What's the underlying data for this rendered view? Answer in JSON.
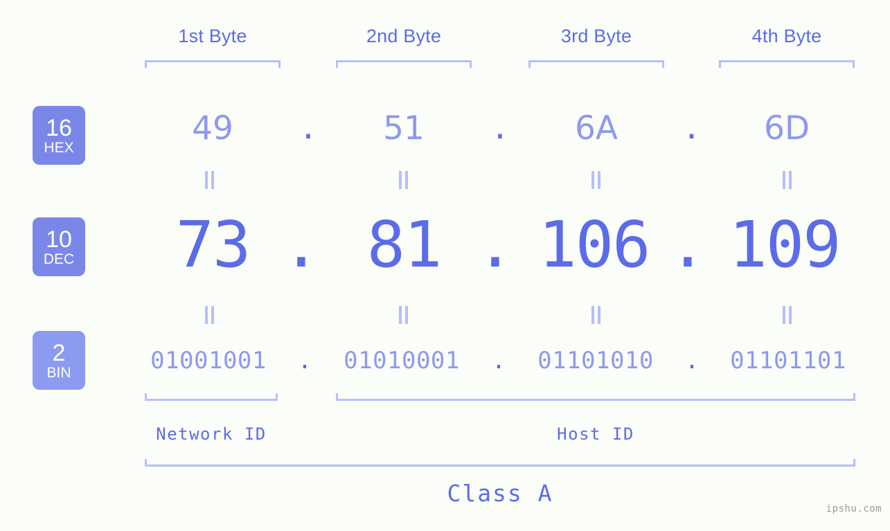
{
  "background_color": "#fbfdf8",
  "accent_color": "#5b6ce8",
  "accent_light_color": "#8d99ef",
  "bracket_color": "#b6bffa",
  "badge_color": "#7b87e8",
  "badge_color_light": "#8c9bf0",
  "headers": {
    "bytes": [
      {
        "label": "1st Byte"
      },
      {
        "label": "2nd Byte"
      },
      {
        "label": "3rd Byte"
      },
      {
        "label": "4th Byte"
      }
    ]
  },
  "rows": {
    "hex": {
      "badge_number": "16",
      "badge_name": "HEX",
      "separator": ".",
      "values": [
        "49",
        "51",
        "6A",
        "6D"
      ]
    },
    "dec": {
      "badge_number": "10",
      "badge_name": "DEC",
      "separator": ".",
      "values": [
        "73",
        "81",
        "106",
        "109"
      ]
    },
    "bin": {
      "badge_number": "2",
      "badge_name": "BIN",
      "separator": ".",
      "values": [
        "01001001",
        "01010001",
        "01101010",
        "01101101"
      ]
    }
  },
  "equals_symbol": "=",
  "footer": {
    "network_id_label": "Network ID",
    "host_id_label": "Host ID",
    "class_label": "Class A"
  },
  "watermark": "ipshu.com"
}
